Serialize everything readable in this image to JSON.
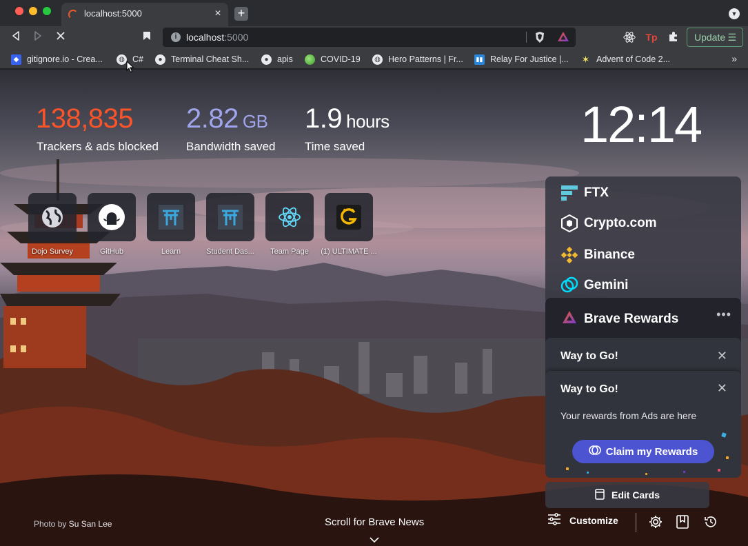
{
  "tab": {
    "title": "localhost:5000",
    "close_label": "×",
    "new_tab_label": "+"
  },
  "toolbar": {
    "url_host": "localhost",
    "url_port": ":5000",
    "update_label": "Update"
  },
  "bookmarks": [
    {
      "label": "gitignore.io - Crea...",
      "icon": "toptal-icon"
    },
    {
      "label": "C#",
      "icon": "globe-icon"
    },
    {
      "label": "Terminal Cheat Sh...",
      "icon": "github-icon"
    },
    {
      "label": "apis",
      "icon": "github-icon"
    },
    {
      "label": "COVID-19",
      "icon": "green-globe-icon"
    },
    {
      "label": "Hero Patterns | Fr...",
      "icon": "globe-icon"
    },
    {
      "label": "Relay For Justice |...",
      "icon": "trello-icon"
    },
    {
      "label": "Advent of Code 2...",
      "icon": "star-icon"
    }
  ],
  "stats": {
    "trackers_value": "138,835",
    "trackers_label": "Trackers & ads blocked",
    "bandwidth_value": "2.82",
    "bandwidth_unit": "GB",
    "bandwidth_label": "Bandwidth saved",
    "time_value": "1.9",
    "time_unit": "hours",
    "time_label": "Time saved",
    "colors": {
      "trackers": "#fb542b",
      "bandwidth": "#a0a5eb",
      "time": "#ffffff"
    }
  },
  "clock": "12:14",
  "top_sites": [
    {
      "label": "Dojo Survey",
      "icon": "globe-icon"
    },
    {
      "label": "GitHub",
      "icon": "github-icon"
    },
    {
      "label": "Learn",
      "icon": "torii-gate-icon"
    },
    {
      "label": "Student Das...",
      "icon": "torii-gate-icon"
    },
    {
      "label": "Team Page",
      "icon": "react-icon"
    },
    {
      "label": "(1) ULTIMATE ...",
      "icon": "g-logo-icon"
    }
  ],
  "exchanges": [
    {
      "label": "FTX",
      "icon": "ftx-icon"
    },
    {
      "label": "Crypto.com",
      "icon": "crypto-com-icon"
    },
    {
      "label": "Binance",
      "icon": "binance-icon"
    },
    {
      "label": "Gemini",
      "icon": "gemini-icon"
    }
  ],
  "rewards": {
    "title": "Brave Rewards",
    "back_notification_title": "Way to Go!",
    "notification_title": "Way to Go!",
    "notification_text": "Your rewards from Ads are here",
    "claim_label": "Claim my Rewards",
    "edit_cards_label": "Edit Cards",
    "button_color": "#4c54d2"
  },
  "footer": {
    "photo_by": "Photo by",
    "photo_author": "Su San Lee",
    "scroll_label": "Scroll for Brave News",
    "customize_label": "Customize"
  }
}
